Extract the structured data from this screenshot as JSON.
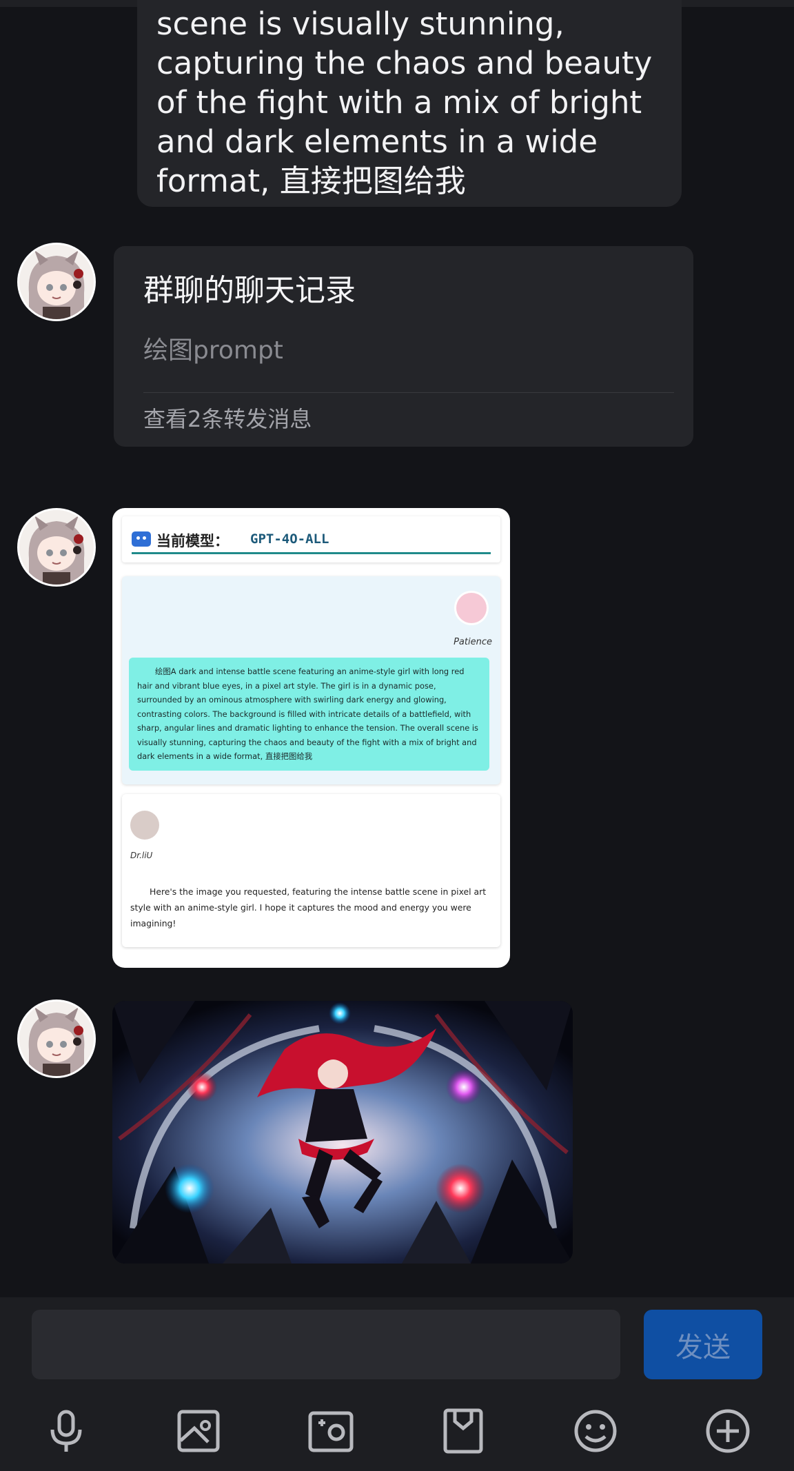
{
  "out_message": {
    "text": "scene is visually stunning,\ncapturing the chaos and beauty\nof the fight with a mix of bright\nand dark elements in a wide\nformat, 直接把图给我"
  },
  "forwarded_card": {
    "title": "群聊的聊天记录",
    "preview": "绘图prompt",
    "more_link": "查看2条转发消息"
  },
  "screenshot_msg": {
    "model_label": "当前模型：",
    "model_name": "GPT-4O-ALL",
    "user_name": "Patience",
    "prompt_text": "绘图A dark and intense battle scene featuring an anime-style girl with long red hair and vibrant blue eyes, in a pixel art style. The girl is in a dynamic pose, surrounded by an ominous atmosphere with swirling dark energy and glowing, contrasting colors. The background is filled with intricate details of a battlefield, with sharp, angular lines and dramatic lighting to enhance the tension. The overall scene is visually stunning, capturing the chaos and beauty of the fight with a mix of bright and dark elements in a wide format, 直接把图给我",
    "bot_name": "Dr.liU",
    "reply_text": "Here's the image you requested, featuring the intense battle scene in pixel art style with an anime-style girl. I hope it captures the mood and energy you were imagining!"
  },
  "input_bar": {
    "placeholder": "",
    "send_label": "发送",
    "tools": [
      "microphone-icon",
      "image-icon",
      "camera-icon",
      "file-icon",
      "emoji-icon",
      "plus-icon"
    ]
  },
  "colors": {
    "background": "#131418",
    "bubble": "#242529",
    "send_button": "#0f4fa3",
    "prompt_highlight": "#7fefe5"
  }
}
